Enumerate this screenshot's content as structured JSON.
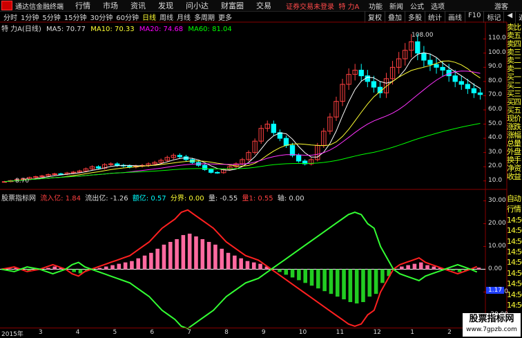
{
  "topbar": {
    "app_name": "通达信金融终端",
    "menus": [
      "行情",
      "市场",
      "资讯",
      "发现",
      "问小达",
      "财富圈",
      "交易"
    ],
    "notice": "证券交易未登录",
    "stock": "特 力A",
    "right": [
      "功能",
      "新闻",
      "公式",
      "选项"
    ],
    "guest": "游客"
  },
  "periods": [
    "分时",
    "1分钟",
    "5分钟",
    "15分钟",
    "30分钟",
    "60分钟",
    "日线",
    "周线",
    "月线",
    "多周期",
    "更多"
  ],
  "active_period": "日线",
  "toolbar": [
    "复权",
    "叠加",
    "多股",
    "统计",
    "画线",
    "F10",
    "标记",
    "◀",
    "返回"
  ],
  "ma_line": {
    "title": "特 力A(日线)",
    "ma5": "MA5: 70.77",
    "ma10": "MA10: 70.33",
    "ma20": "MA20: 74.68",
    "ma60": "MA60: 81.04"
  },
  "indicator": {
    "name": "股票指标网",
    "inflow": "流入亿: 1.84",
    "outflow": "流出亿: -1.26",
    "net": "额亿: 0.57",
    "boundary": "分界: 0.00",
    "vol": "量: -0.55",
    "red": "量1: 0.55",
    "axis": "轴: 0.00"
  },
  "side_labels": [
    "卖比",
    "卖五",
    "卖四",
    "卖三",
    "卖二",
    "卖一",
    "买一",
    "买二",
    "买三",
    "买四",
    "买五",
    "现价",
    "涨跌",
    "涨幅",
    "总量",
    "外盘",
    "换手",
    "净资",
    "收益"
  ],
  "side_labels2": [
    "自动",
    "行情",
    "14:56",
    "14:56",
    "14:56",
    "14:56",
    "14:56",
    "14:56",
    "14:56",
    "14:56",
    "14:56"
  ],
  "price_axis": [
    "110.0",
    "100.0",
    "90.0",
    "80.0",
    "70.0",
    "60.0",
    "50.0",
    "40.0",
    "30.0",
    "20.0",
    "10.0"
  ],
  "ind_axis": [
    "30.00",
    "20.00",
    "10.00",
    "0.00",
    "-10.00",
    "-20.00"
  ],
  "peak_label": "108.00",
  "low_label": "8.70",
  "cur_value": "1.17",
  "date_labels": [
    "2015年",
    "3",
    "4",
    "5",
    "6",
    "7",
    "8",
    "9",
    "10",
    "11",
    "12",
    "1",
    "2"
  ],
  "watermark": {
    "title": "股票指标网",
    "url": "www.7gpzb.com"
  },
  "chart_data": {
    "type": "line",
    "price_candles_close": [
      9.5,
      10.2,
      11,
      11.5,
      12.4,
      13,
      13.6,
      14.5,
      15,
      14.8,
      15.6,
      16.2,
      17,
      18.5,
      20,
      19,
      21.5,
      22,
      21,
      20.5,
      19.8,
      20.4,
      20.9,
      22,
      23,
      24.5,
      26.5,
      28,
      27,
      25,
      23,
      21,
      18,
      16,
      15.8,
      18,
      20,
      22,
      25,
      30,
      38,
      47,
      50,
      44,
      40,
      35,
      28,
      24,
      22,
      25,
      35,
      45,
      55,
      66,
      78,
      85,
      88,
      84,
      80,
      76,
      72,
      82,
      90,
      96,
      102,
      108,
      100,
      95,
      92,
      90,
      88,
      84,
      80,
      78,
      75,
      72,
      70.8
    ],
    "ma_lines": {
      "ma5": 70.77,
      "ma10": 70.33,
      "ma20": 74.68,
      "ma60": 81.04
    },
    "indicator_red": [
      0,
      0.5,
      1,
      0,
      -1,
      -0.5,
      0,
      1,
      2,
      1,
      0,
      -2,
      -3,
      -1,
      0,
      1,
      2,
      3,
      4,
      5,
      6,
      8,
      10,
      12,
      15,
      18,
      20,
      22,
      25,
      26,
      24,
      22,
      20,
      18,
      15,
      12,
      10,
      8,
      6,
      5,
      4,
      2,
      0,
      -2,
      -4,
      -6,
      -8,
      -10,
      -12,
      -14,
      -16,
      -18,
      -20,
      -22,
      -24,
      -25,
      -24,
      -20,
      -18,
      -10,
      -5,
      0,
      2,
      3,
      4,
      5,
      3,
      2,
      1,
      0,
      -1,
      -2,
      -1,
      0,
      1.17
    ],
    "indicator_green": [
      0,
      -0.5,
      -1,
      0,
      1,
      0.5,
      0,
      -1,
      -2,
      -1,
      0,
      2,
      3,
      1,
      0,
      -1,
      -2,
      -3,
      -4,
      -5,
      -6,
      -8,
      -10,
      -12,
      -15,
      -18,
      -20,
      -22,
      -25,
      -26,
      -24,
      -22,
      -20,
      -18,
      -15,
      -12,
      -10,
      -8,
      -6,
      -5,
      -4,
      -2,
      0,
      2,
      4,
      6,
      8,
      10,
      12,
      14,
      16,
      18,
      20,
      22,
      24,
      25,
      24,
      20,
      18,
      10,
      5,
      0,
      -2,
      -3,
      -4,
      -5,
      -3,
      -2,
      -1,
      0,
      1,
      2,
      1,
      0,
      -1.17
    ],
    "price_ylim": [
      5,
      115
    ],
    "ind_ylim": [
      -25,
      32
    ]
  }
}
